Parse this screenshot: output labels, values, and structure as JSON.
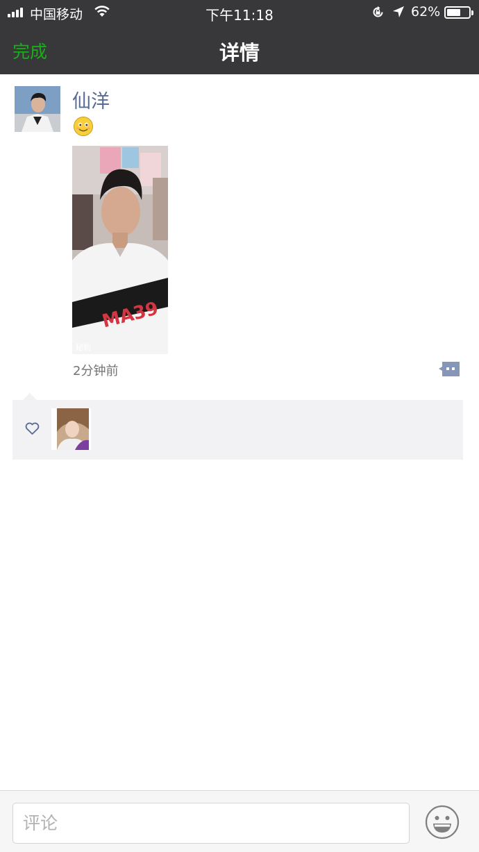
{
  "status_bar": {
    "carrier": "中国移动",
    "time": "下午11:18",
    "battery": "62%",
    "battery_level": 0.62
  },
  "nav": {
    "done_label": "完成",
    "title": "详情"
  },
  "post": {
    "author": "仙洋",
    "timestamp": "2分钟前",
    "photo_watermark": "秘制"
  },
  "comment_bar": {
    "placeholder": "评论"
  },
  "colors": {
    "nav_background": "#38383a",
    "done_green": "#1aad19",
    "name_blue": "#576b95",
    "like_area": "#f2f2f5"
  },
  "icons": {
    "signal": "signal-icon",
    "wifi": "wifi-icon",
    "orientation_lock": "orientation-lock-icon",
    "location": "location-arrow-icon",
    "battery": "battery-icon",
    "smiley": "smiley-emoji-icon",
    "comment": "comment-bubble-icon",
    "like": "heart-icon",
    "emoji": "emoji-face-icon"
  }
}
